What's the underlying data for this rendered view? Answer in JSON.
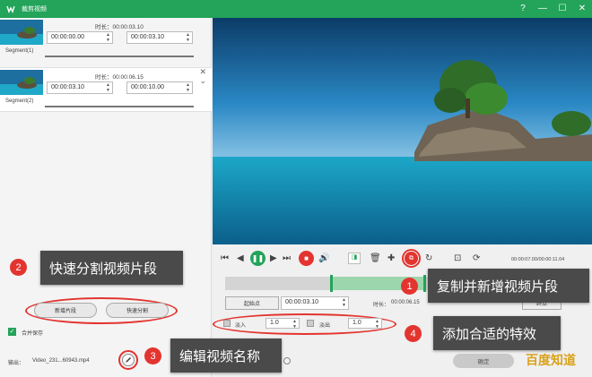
{
  "window": {
    "title": "裁剪视频",
    "controls": [
      "?",
      "—",
      "☐",
      "✕"
    ]
  },
  "segments": [
    {
      "duration_label": "时长：00:00:03.10",
      "start": "00:00:00.00",
      "end": "00:00:03.10",
      "name": "Segment(1)"
    },
    {
      "duration_label": "时长：00:00:06.15",
      "start": "00:00:03.10",
      "end": "00:00:10.00",
      "name": "Segment(2)"
    }
  ],
  "left_buttons": {
    "split": "新增片段",
    "quick_split": "快速分割"
  },
  "merge_label": "合并保存",
  "output": {
    "label": "输出：",
    "filename": "Video_231...60943.mp4"
  },
  "callouts": {
    "c1": {
      "num": "1",
      "text": "复制并新增视频片段"
    },
    "c2": {
      "num": "2",
      "text": "快速分割视频片段"
    },
    "c3": {
      "num": "3",
      "text": "编辑视频名称"
    },
    "c4": {
      "num": "4",
      "text": "添加合适的特效"
    }
  },
  "player": {
    "time_display": "00:00:07.00/00:00:11.04"
  },
  "trim": {
    "start_label": "起始点",
    "start_value": "00:00:03.10",
    "duration_label": "时长：",
    "duration_value": "00:00:06.15",
    "end_button": "终点"
  },
  "fade": {
    "fade_in_label": "淡入",
    "fade_in_value": "1.0",
    "fade_out_label": "淡出",
    "fade_out_value": "1.0"
  },
  "ok_button": "确定",
  "watermark": "百度知道",
  "colors": {
    "accent": "#24a35a",
    "callout_red": "#e3342f",
    "timeline_green": "#9cd6ad"
  }
}
